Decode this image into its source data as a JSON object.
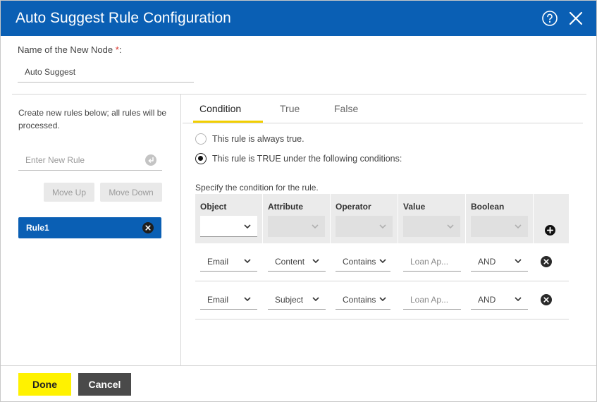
{
  "dialog": {
    "title": "Auto Suggest Rule Configuration",
    "help_icon": "question-circle-icon",
    "close_icon": "close-x-icon",
    "header_color": "#0a5fb4"
  },
  "node": {
    "label": "Name of the New Node",
    "required_mark": "*",
    "value": "Auto Suggest"
  },
  "left_panel": {
    "help_text": "Create new rules below; all rules will be processed.",
    "new_rule_placeholder": "Enter New Rule",
    "enter_icon": "enter-return-icon",
    "move_up_label": "Move Up",
    "move_down_label": "Move Down",
    "rules": [
      {
        "label": "Rule1",
        "selected": true
      }
    ]
  },
  "tabs": [
    {
      "label": "Condition",
      "active": true
    },
    {
      "label": "True",
      "active": false
    },
    {
      "label": "False",
      "active": false
    }
  ],
  "condition": {
    "option_always_true": "This rule is always true.",
    "option_conditional": "This rule is TRUE under the following conditions:",
    "selected_option": "conditional",
    "spec_label": "Specify the condition for the rule.",
    "columns": [
      "Object",
      "Attribute",
      "Operator",
      "Value",
      "Boolean"
    ],
    "rows": [
      {
        "object": "Email",
        "attribute": "Content",
        "operator": "Contains",
        "value": "Loan Ap...",
        "boolean": "AND"
      },
      {
        "object": "Email",
        "attribute": "Subject",
        "operator": "Contains",
        "value": "Loan Ap...",
        "boolean": "AND"
      }
    ]
  },
  "footer": {
    "done_label": "Done",
    "cancel_label": "Cancel",
    "done_color": "#fff200",
    "cancel_color": "#4a4a4a"
  }
}
